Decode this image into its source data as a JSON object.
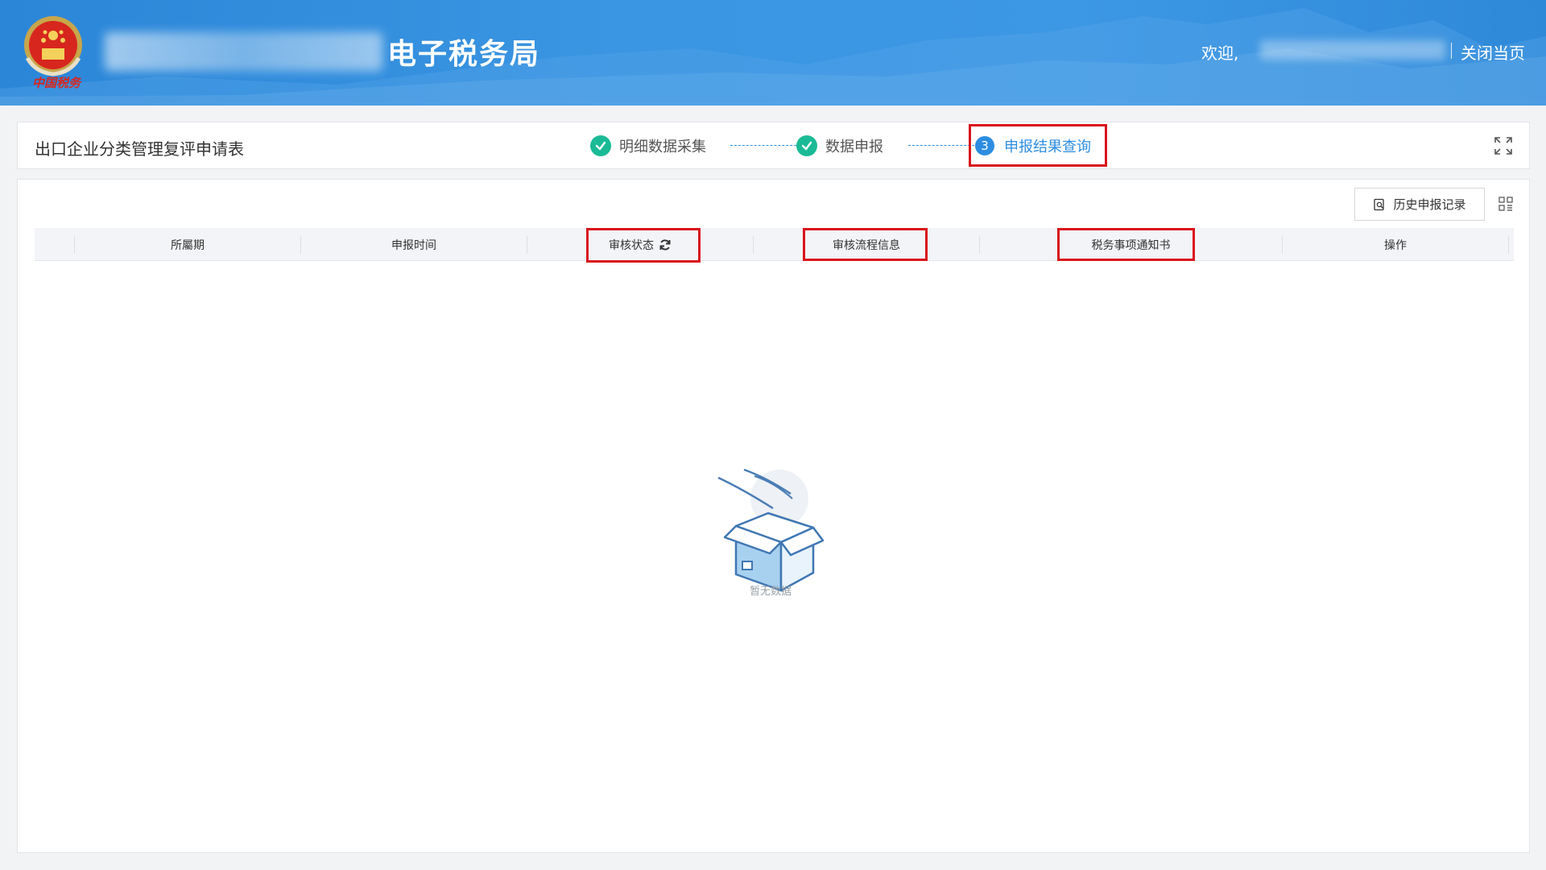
{
  "header": {
    "emblem_text": "中国税务",
    "title": "电子税务局",
    "welcome": "欢迎,",
    "close_page": "关闭当页"
  },
  "stepbar": {
    "form_title": "出口企业分类管理复评申请表",
    "steps": [
      {
        "label": "明细数据采集",
        "state": "done"
      },
      {
        "label": "数据申报",
        "state": "done"
      },
      {
        "label": "申报结果查询",
        "state": "active",
        "number": "3"
      }
    ]
  },
  "toolbar": {
    "history_button": "历史申报记录"
  },
  "table": {
    "columns": [
      {
        "label": "所屬期"
      },
      {
        "label": "申报时间"
      },
      {
        "label": "审核状态"
      },
      {
        "label": "审核流程信息"
      },
      {
        "label": "税务事项通知书"
      },
      {
        "label": "操作"
      }
    ],
    "empty_text": "暂无数据"
  },
  "colors": {
    "header_blue": "#3a95e2",
    "step_done": "#1aba96",
    "step_active": "#2d8de0",
    "highlight_red": "#d9141c"
  }
}
